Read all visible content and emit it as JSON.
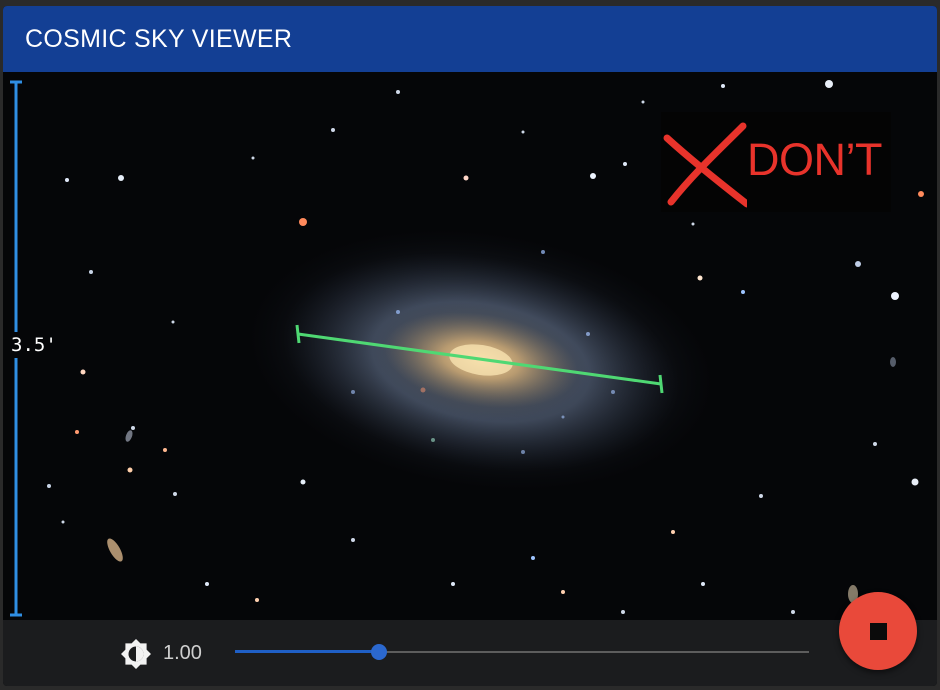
{
  "app": {
    "title": "COSMIC SKY VIEWER"
  },
  "viewer": {
    "scale_label": "3.5'",
    "scale_bar_color": "#2f8fe4",
    "measure_line_color": "#4fd873"
  },
  "badge": {
    "icon": "x-mark-icon",
    "text": "DON’T",
    "color": "#e8332b"
  },
  "controls": {
    "brightness_icon": "brightness-icon",
    "brightness_value": "1.00",
    "brightness_slider_fraction": 0.25,
    "accent_color": "#1f5fc6",
    "stop_icon": "stop-icon",
    "stop_button_color": "#e9493a"
  }
}
